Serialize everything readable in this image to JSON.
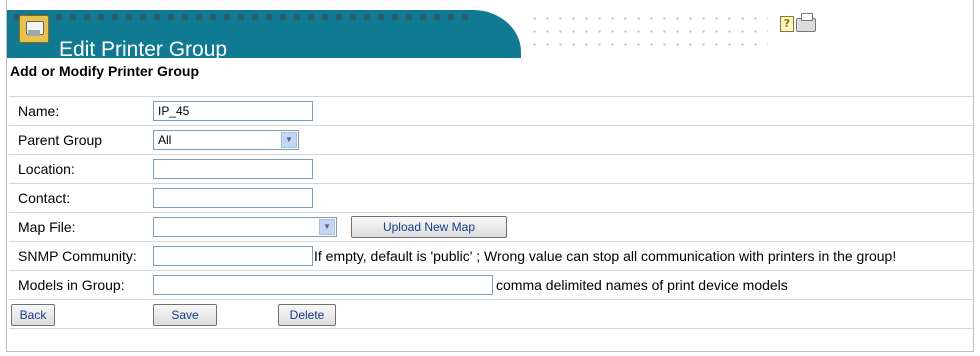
{
  "header": {
    "title": "Edit Printer Group",
    "help_icon": "help-icon",
    "print_icon": "printer-icon",
    "accent_color": "#0f7a92"
  },
  "section_title": "Add or Modify Printer Group",
  "form": {
    "name": {
      "label": "Name:",
      "value": "IP_45"
    },
    "parent_group": {
      "label": "Parent Group",
      "value": "All"
    },
    "location": {
      "label": "Location:",
      "value": ""
    },
    "contact": {
      "label": "Contact:",
      "value": ""
    },
    "map_file": {
      "label": "Map File:",
      "value": "",
      "upload_button": "Upload New Map"
    },
    "snmp_community": {
      "label": "SNMP Community:",
      "value": "",
      "hint": "If empty, default is 'public' ; Wrong value can stop all communication with printers in the group!"
    },
    "models": {
      "label": "Models in Group:",
      "value": "",
      "hint": "comma delimited names of print device models"
    }
  },
  "actions": {
    "back": "Back",
    "save": "Save",
    "delete": "Delete"
  }
}
